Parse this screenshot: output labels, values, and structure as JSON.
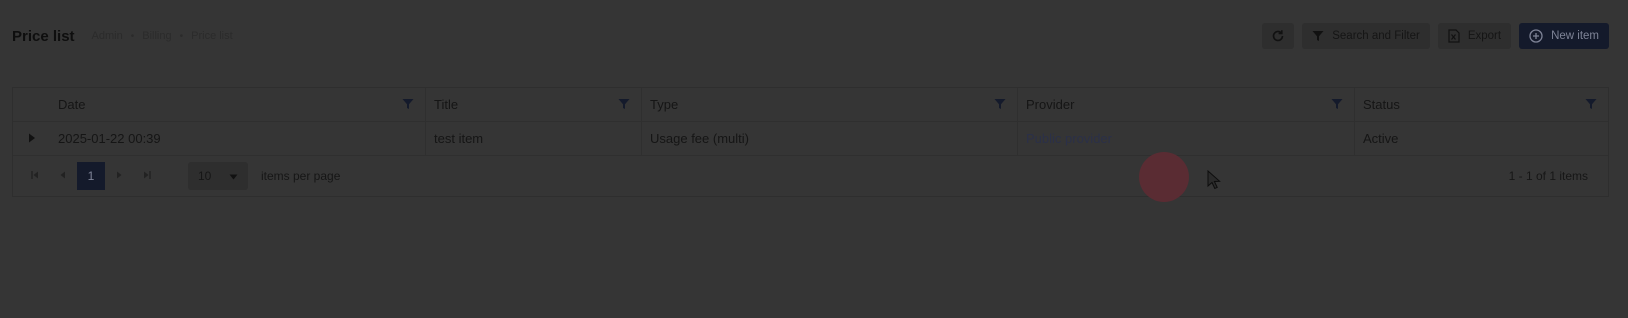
{
  "header": {
    "title": "Price list",
    "breadcrumb": [
      "Admin",
      "Billing",
      "Price list"
    ],
    "breadcrumb_sep": "•"
  },
  "toolbar": {
    "refresh_icon": "refresh-icon",
    "search_filter_label": "Search and Filter",
    "export_label": "Export",
    "new_item_label": "New item"
  },
  "table": {
    "columns": [
      "Date",
      "Title",
      "Type",
      "Provider",
      "Status"
    ],
    "rows": [
      {
        "date": "2025-01-22 00:39",
        "title": "test item",
        "type": "Usage fee (multi)",
        "provider": "Public provider",
        "status": "Active"
      }
    ]
  },
  "pager": {
    "current_page": "1",
    "page_size": "10",
    "per_page_label": "items per page",
    "range_text": "1 - 1 of 1 items"
  },
  "colors": {
    "overlay": "#353535",
    "primary": "#141a2b",
    "cursor_highlight": "#5a2c33"
  }
}
